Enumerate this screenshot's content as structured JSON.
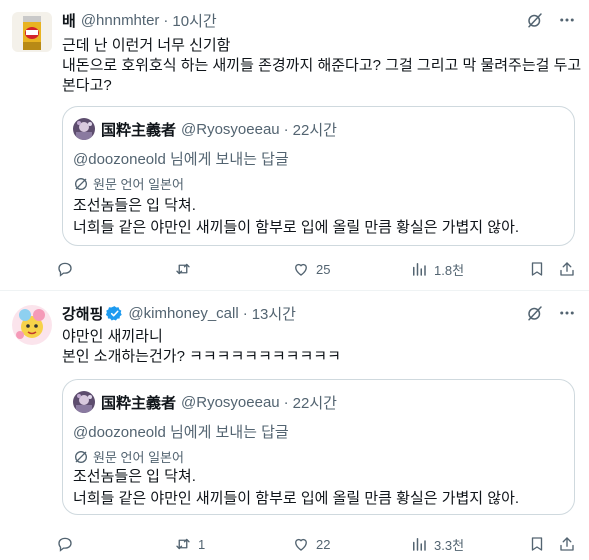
{
  "posts": [
    {
      "name": "배",
      "handle": "@hnnmhter",
      "separator": "·",
      "time": "10시간",
      "text_lines": [
        "근데 난 이런거 너무 신기함",
        "내돈으로 호위호식 하는 새끼들 존경까지 해준다고? 그걸 그리고 막 물려주는걸 두고",
        "본다고?"
      ],
      "quote": {
        "name": "国粋主義者",
        "handle": "@Ryosyoeeau",
        "separator": "·",
        "time": "22시간",
        "reply_to": "@doozoneold 님에게 보내는 답글",
        "translate_label": "원문 언어 일본어",
        "text_lines": [
          "조선놈들은 입 닥쳐.",
          "너희들 같은 야만인 새끼들이 함부로 입에 올릴 만큼 황실은 가볍지 않아."
        ]
      },
      "actions": {
        "replies": "",
        "retweets": "",
        "likes": "25",
        "views": "1.8천"
      }
    },
    {
      "name": "강해핑",
      "handle": "@kimhoney_call",
      "separator": "·",
      "time": "13시간",
      "text_lines": [
        "야만인 새끼라니",
        "본인 소개하는건가? ㅋㅋㅋㅋㅋㅋㅋㅋㅋㅋㅋ"
      ],
      "quote": {
        "name": "国粋主義者",
        "handle": "@Ryosyoeeau",
        "separator": "·",
        "time": "22시간",
        "reply_to": "@doozoneold 님에게 보내는 답글",
        "translate_label": "원문 언어 일본어",
        "text_lines": [
          "조선놈들은 입 닥쳐.",
          "너희들 같은 야만인 새끼들이 함부로 입에 올릴 만큼 황실은 가볍지 않아."
        ]
      },
      "actions": {
        "replies": "",
        "retweets": "1",
        "likes": "22",
        "views": "3.3천"
      }
    }
  ],
  "colors": {
    "text": "#0f1419",
    "secondary": "#536471",
    "border": "#cfd9de",
    "verified": "#1d9bf0"
  },
  "icons": [
    "grok-icon",
    "more-icon",
    "reply-icon",
    "retweet-icon",
    "like-icon",
    "views-icon",
    "bookmark-icon",
    "share-icon",
    "translate-icon",
    "verified-icon"
  ]
}
